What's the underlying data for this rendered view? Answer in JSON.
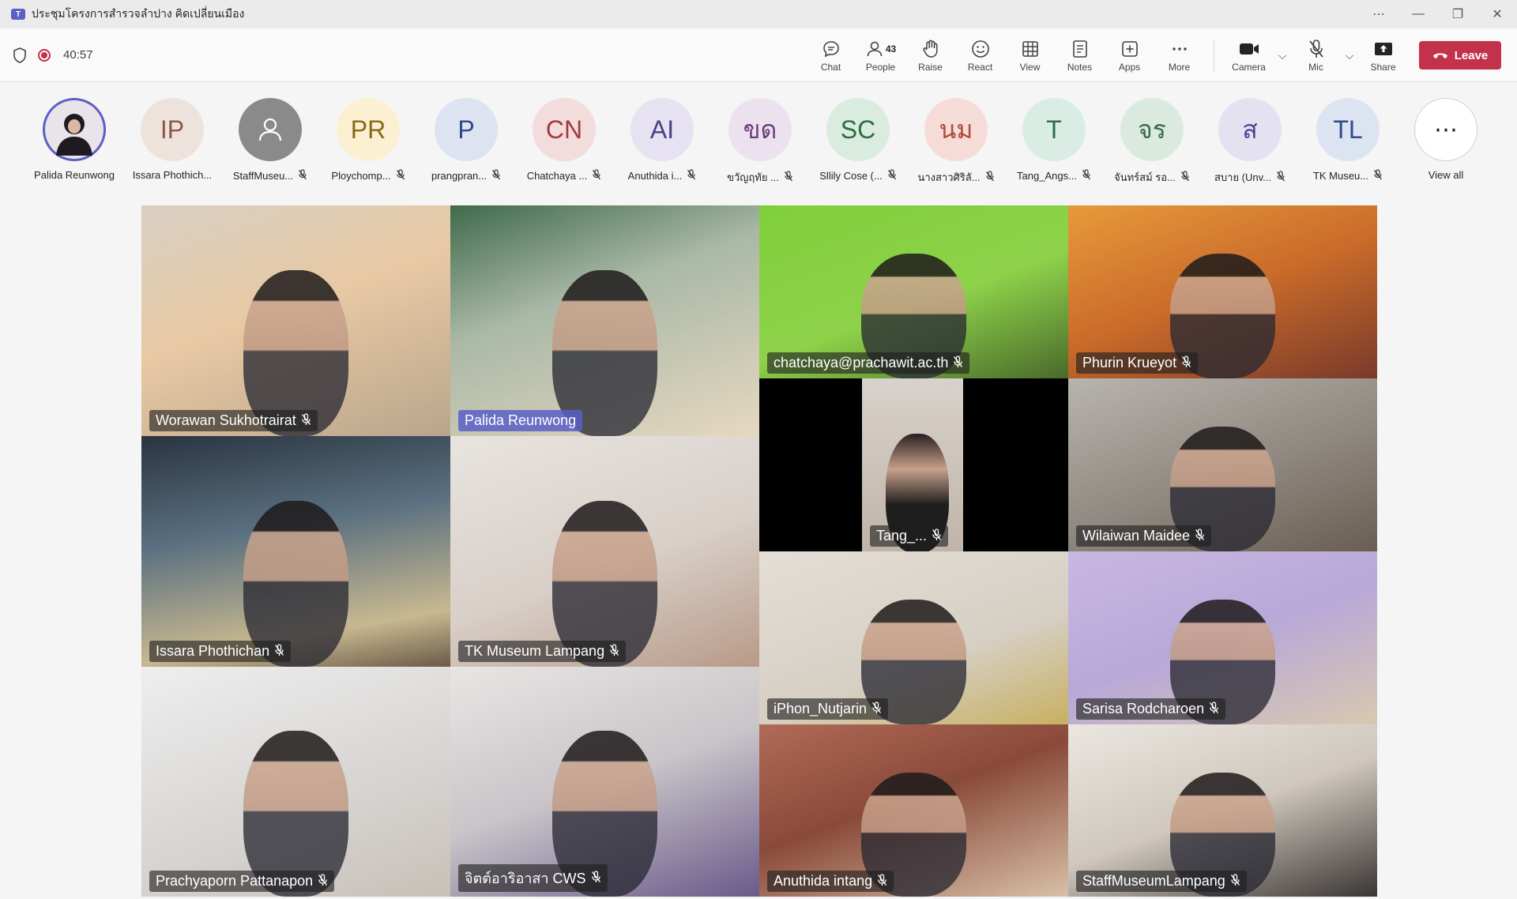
{
  "window": {
    "title": "ประชุมโครงการสำรวจลำปาง คิดเปลี่ยนเมือง",
    "controls": [
      "⋯",
      "—",
      "❐",
      "✕"
    ]
  },
  "meeting": {
    "timer": "40:57"
  },
  "toolbar": {
    "chat": "Chat",
    "people": "People",
    "people_count": "43",
    "raise": "Raise",
    "react": "React",
    "view": "View",
    "notes": "Notes",
    "apps": "Apps",
    "more": "More",
    "camera": "Camera",
    "mic": "Mic",
    "share": "Share",
    "leave": "Leave"
  },
  "attendees": [
    {
      "initials": "",
      "name": "Palida Reunwong",
      "muted": false,
      "bg": "#2b2b3a",
      "fg": "#fff"
    },
    {
      "initials": "IP",
      "name": "Issara Phothich...",
      "muted": false,
      "bg": "#eee3dc",
      "fg": "#8a5a44"
    },
    {
      "initials": "",
      "name": "StaffMuseu...",
      "muted": true,
      "bg": "#8a8a8a",
      "fg": "#fff"
    },
    {
      "initials": "PR",
      "name": "Ploychomp...",
      "muted": true,
      "bg": "#fbf0d2",
      "fg": "#8a6a16"
    },
    {
      "initials": "P",
      "name": "prangpran...",
      "muted": true,
      "bg": "#dde3f0",
      "fg": "#2f4a8a"
    },
    {
      "initials": "CN",
      "name": "Chatchaya ...",
      "muted": true,
      "bg": "#f2dcdc",
      "fg": "#a33b3b"
    },
    {
      "initials": "AI",
      "name": "Anuthida i...",
      "muted": true,
      "bg": "#e6e2f2",
      "fg": "#4b3f8a"
    },
    {
      "initials": "ขด",
      "name": "ขวัญฤทัย ...",
      "muted": true,
      "bg": "#ece2ef",
      "fg": "#6a3f7a"
    },
    {
      "initials": "SC",
      "name": "Sllily Cose (...",
      "muted": true,
      "bg": "#d9ecdf",
      "fg": "#2f6b43"
    },
    {
      "initials": "นม",
      "name": "นางสาวศิริลั...",
      "muted": true,
      "bg": "#f6dcd7",
      "fg": "#b04a38"
    },
    {
      "initials": "T",
      "name": "Tang_Angs...",
      "muted": true,
      "bg": "#d9ede4",
      "fg": "#2e6b55"
    },
    {
      "initials": "จร",
      "name": "จันทร์สม์ รอ...",
      "muted": true,
      "bg": "#dbeadf",
      "fg": "#3a6b4a"
    },
    {
      "initials": "ส",
      "name": "สบาย (Unv...",
      "muted": true,
      "bg": "#e4e1f1",
      "fg": "#4a4590"
    },
    {
      "initials": "TL",
      "name": "TK Museu...",
      "muted": true,
      "bg": "#dde4f1",
      "fg": "#2f4a8a"
    },
    {
      "initials": "⋯",
      "name": "View all",
      "muted": false,
      "bg": "#ffffff",
      "fg": "#242424"
    }
  ],
  "tiles": [
    {
      "name": "Worawan Sukhotrairat",
      "active": false,
      "bg": "linear-gradient(160deg,#d8cfc2 0%,#e8c9a4 45%,#b9a58c 100%)"
    },
    {
      "name": "Palida Reunwong",
      "active": true,
      "bg": "linear-gradient(160deg,#3f6a4a 0%,#a9b8a6 40%,#e6d8c0 100%)"
    },
    {
      "name": "chatchaya@prachawit.ac.th",
      "active": false,
      "bg": "linear-gradient(160deg,#7fcf3a 0%,#8ed24a 55%,#4a6a2a 100%)"
    },
    {
      "name": "Phurin Krueyot",
      "active": false,
      "bg": "linear-gradient(160deg,#e79a3a 0%,#c96b2a 50%,#7a3a2a 100%)"
    },
    {
      "name": "Tang_...",
      "active": false,
      "bg": "linear-gradient(180deg,#d8d2cc 0%,#c0b4a8 100%)"
    },
    {
      "name": "Wilaiwan Maidee",
      "active": false,
      "bg": "linear-gradient(160deg,#b8b4ae 0%,#8f8880 55%,#6a5e52 100%)"
    },
    {
      "name": "Issara Phothichan",
      "active": false,
      "bg": "linear-gradient(170deg,#2a3440 0%,#5a7080 40%,#c8b890 80%,#6a5a48 100%)"
    },
    {
      "name": "TK Museum Lampang",
      "active": false,
      "bg": "linear-gradient(160deg,#e8e4e0 0%,#d8cfc8 55%,#b89a88 100%)"
    },
    {
      "name": "iPhon_Nutjarin",
      "active": false,
      "bg": "linear-gradient(160deg,#e4ded6 0%,#d6cfc4 60%,#c8b060 100%)"
    },
    {
      "name": "Sarisa Rodcharoen",
      "active": false,
      "bg": "linear-gradient(160deg,#c8b8e0 0%,#b8a8d8 50%,#d8c8b0 100%)"
    },
    {
      "name": "Prachyaporn Pattanapon",
      "active": false,
      "bg": "linear-gradient(160deg,#eeeeee 0%,#d8d6d4 55%,#c8c0b8 100%)"
    },
    {
      "name": "จิตต์อาริอาสา CWS",
      "active": false,
      "bg": "linear-gradient(160deg,#e8e6e4 0%,#c8c4c8 50%,#6a5a8a 100%)"
    },
    {
      "name": "Anuthida intang",
      "active": false,
      "bg": "linear-gradient(160deg,#b06a58 0%,#8a4a3a 45%,#d8c0a8 100%)"
    },
    {
      "name": "StaffMuseumLampang",
      "active": false,
      "bg": "linear-gradient(160deg,#eae6e0 0%,#d0c8be 50%,#3a3634 100%)"
    }
  ]
}
